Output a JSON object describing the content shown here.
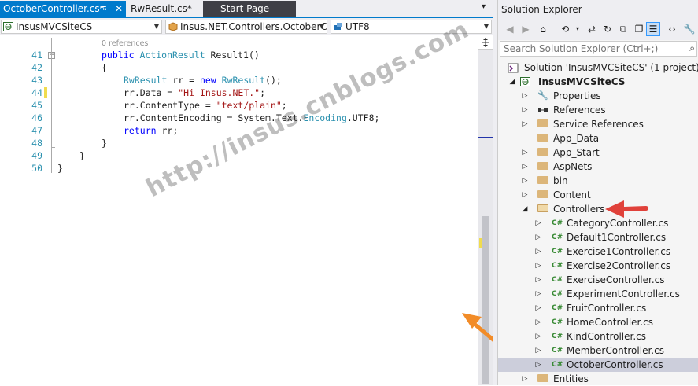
{
  "editor": {
    "tabs": [
      {
        "label": "OctoberController.cs*",
        "active": true
      },
      {
        "label": "RwResult.cs*",
        "active": false
      },
      {
        "label": "Start Page",
        "active": false
      }
    ],
    "nav": {
      "project": "InsusMVCSiteCS",
      "class": "Insus.NET.Controllers.OctoberCo",
      "member": "UTF8"
    },
    "codelens": "0 references",
    "lines": [
      {
        "num": "41"
      },
      {
        "num": "42"
      },
      {
        "num": "43"
      },
      {
        "num": "44"
      },
      {
        "num": "45"
      },
      {
        "num": "46"
      },
      {
        "num": "47"
      },
      {
        "num": "48"
      },
      {
        "num": "49"
      },
      {
        "num": "50"
      }
    ],
    "code": {
      "l41_kw": "public",
      "l41_type": "ActionResult",
      "l41_rest": " Result1()",
      "l42": "{",
      "l43_type": "RwResult",
      "l43_mid": " rr = ",
      "l43_kw": "new",
      "l43_type2": "RwResult",
      "l43_end": "();",
      "l44_start": "rr.Data = ",
      "l44_str": "\"Hi Insus.NET.\"",
      "l44_end": ";",
      "l45_start": "rr.ContentType = ",
      "l45_str": "\"text/plain\"",
      "l45_end": ";",
      "l46_start": "rr.ContentEncoding = System.Text.",
      "l46_type": "Encoding",
      "l46_end": ".UTF8;",
      "l47_kw": "return",
      "l47_rest": " rr;",
      "l48": "}",
      "l49": "}",
      "l50": "}"
    },
    "watermark": "http://insus.cnblogs.com"
  },
  "solution_explorer": {
    "title": "Solution Explorer",
    "search_placeholder": "Search Solution Explorer (Ctrl+;)",
    "tree": [
      {
        "label": "Solution 'InsusMVCSiteCS' (1 project)",
        "icon": "solution-icon"
      },
      {
        "label": "InsusMVCSiteCS",
        "icon": "web-project-icon"
      },
      {
        "label": "Properties",
        "icon": "wrench-icon"
      },
      {
        "label": "References",
        "icon": "references-icon"
      },
      {
        "label": "Service References",
        "icon": "folder-icon"
      },
      {
        "label": "App_Data",
        "icon": "folder-icon"
      },
      {
        "label": "App_Start",
        "icon": "folder-icon"
      },
      {
        "label": "AspNets",
        "icon": "folder-icon"
      },
      {
        "label": "bin",
        "icon": "folder-icon"
      },
      {
        "label": "Content",
        "icon": "folder-icon"
      },
      {
        "label": "Controllers",
        "icon": "folder-open-icon"
      },
      {
        "label": "CategoryController.cs",
        "icon": "csharp-file-icon"
      },
      {
        "label": "Default1Controller.cs",
        "icon": "csharp-file-icon"
      },
      {
        "label": "Exercise1Controller.cs",
        "icon": "csharp-file-icon"
      },
      {
        "label": "Exercise2Controller.cs",
        "icon": "csharp-file-icon"
      },
      {
        "label": "ExerciseController.cs",
        "icon": "csharp-file-icon"
      },
      {
        "label": "ExperimentController.cs",
        "icon": "csharp-file-icon"
      },
      {
        "label": "FruitController.cs",
        "icon": "csharp-file-icon"
      },
      {
        "label": "HomeController.cs",
        "icon": "csharp-file-icon"
      },
      {
        "label": "KindController.cs",
        "icon": "csharp-file-icon"
      },
      {
        "label": "MemberController.cs",
        "icon": "csharp-file-icon"
      },
      {
        "label": "OctoberController.cs",
        "icon": "csharp-file-icon",
        "selected": true
      },
      {
        "label": "Entities",
        "icon": "folder-icon"
      }
    ],
    "csharp_glyph": "C#"
  },
  "colors": {
    "accent": "#007acc",
    "keyword": "#0000ff",
    "type": "#2b91af",
    "string": "#a31515",
    "annotation_orange": "#f28c28",
    "annotation_red": "#e0413a"
  }
}
